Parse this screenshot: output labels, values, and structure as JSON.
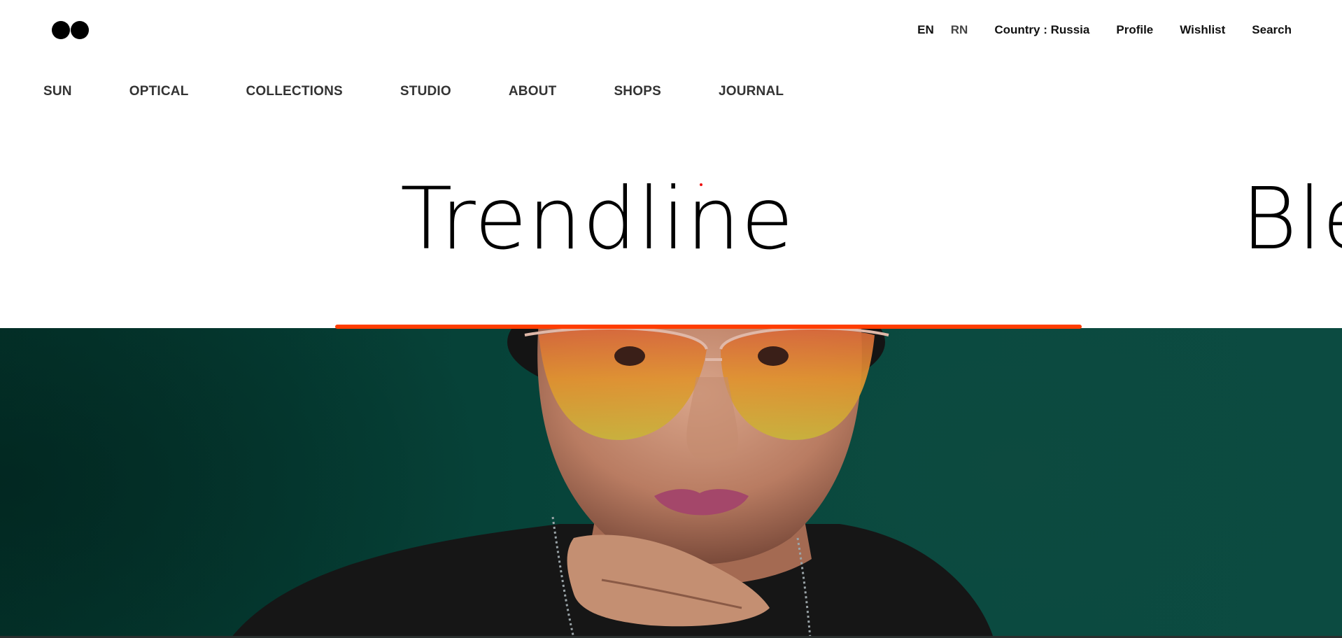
{
  "header": {
    "languages": [
      {
        "label": "EN",
        "active": true
      },
      {
        "label": "RN",
        "active": false
      }
    ],
    "country": "Country : Russia",
    "profile": "Profile",
    "wishlist": "Wishlist",
    "search": "Search"
  },
  "nav": {
    "items": [
      "SUN",
      "OPTICAL",
      "COLLECTIONS",
      "STUDIO",
      "ABOUT",
      "SHOPS",
      "JOURNAL"
    ]
  },
  "slider": {
    "titles": [
      "Trendline",
      "Ble"
    ],
    "active_index": 0
  },
  "colors": {
    "accent": "#ff3d00",
    "hero_background": "#064238",
    "text": "#000000",
    "nav_text": "#333333"
  },
  "icons": {
    "logo": "double-circle-logo"
  }
}
